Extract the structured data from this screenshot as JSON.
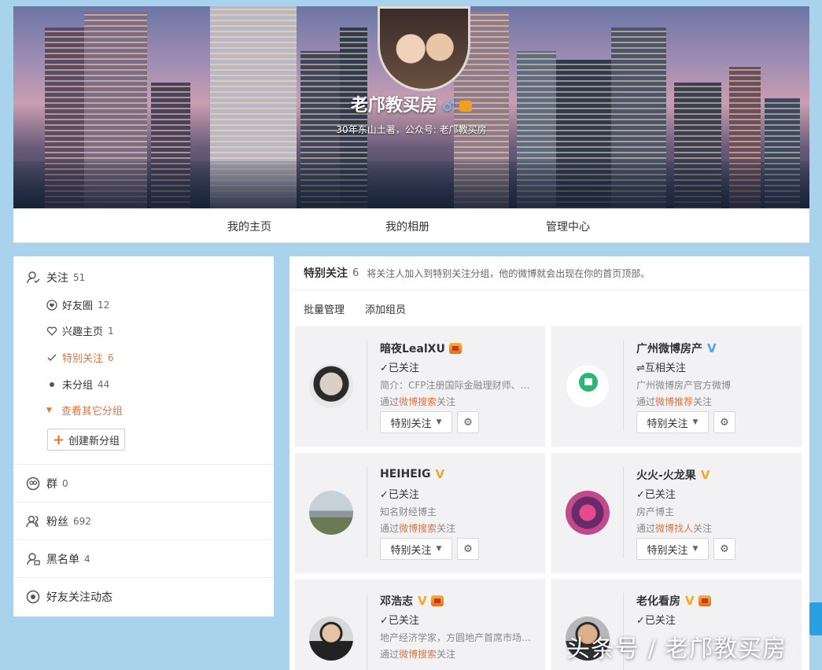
{
  "profile": {
    "name": "老邝教买房",
    "gender_icon": "♂",
    "description": "30年东山土著，公众号: 老邝教买房"
  },
  "nav": {
    "home": "我的主页",
    "album": "我的相册",
    "manage": "管理中心"
  },
  "sidebar": {
    "follow_label": "关注",
    "follow_count": "51",
    "friends_label": "好友圈",
    "friends_count": "12",
    "interest_label": "兴趣主页",
    "interest_count": "1",
    "special_label": "特别关注",
    "special_count": "6",
    "ungrouped_label": "未分组",
    "ungrouped_count": "44",
    "more_groups": "查看其它分组",
    "create_group": "创建新分组",
    "groups_label": "群",
    "groups_count": "0",
    "fans_label": "粉丝",
    "fans_count": "692",
    "blacklist_label": "黑名单",
    "blacklist_count": "4",
    "friends_feed": "好友关注动态"
  },
  "main": {
    "title": "特别关注",
    "count": "6",
    "desc": "将关注人加入到特别关注分组，他的微博就会出现在你的首页顶部。",
    "batch": "批量管理",
    "add_member": "添加组员",
    "button_label": "特别关注",
    "cards": [
      {
        "name": "暗夜LealXU",
        "status": "已关注",
        "desc": "简介：CFP注册国际金融理财师、…",
        "via_prefix": "通过",
        "via_link": "微博搜索",
        "via_suffix": "关注"
      },
      {
        "name": "广州微博房产",
        "status": "互相关注",
        "desc": "广州微博房产官方微博",
        "via_prefix": "通过",
        "via_link": "微博推荐",
        "via_suffix": "关注"
      },
      {
        "name": "HEIHEIG",
        "status": "已关注",
        "desc": "知名财经博主",
        "via_prefix": "通过",
        "via_link": "微博搜索",
        "via_suffix": "关注"
      },
      {
        "name": "火火-火龙果",
        "status": "已关注",
        "desc": "房产博主",
        "via_prefix": "通过",
        "via_link": "微博找人",
        "via_suffix": "关注"
      },
      {
        "name": "邓浩志",
        "status": "已关注",
        "desc": "地产经济学家，方圆地产首席市场…",
        "via_prefix": "通过",
        "via_link": "微博搜索",
        "via_suffix": "关注"
      },
      {
        "name": "老化看房",
        "status": "已关注",
        "desc": "",
        "via_prefix": "",
        "via_link": "",
        "via_suffix": ""
      }
    ]
  },
  "watermark": "头条号 / 老邝教买房",
  "colors": {
    "accent": "#e5733a",
    "verified_gold": "#f5a623",
    "verified_blue": "#4aa3f0"
  }
}
